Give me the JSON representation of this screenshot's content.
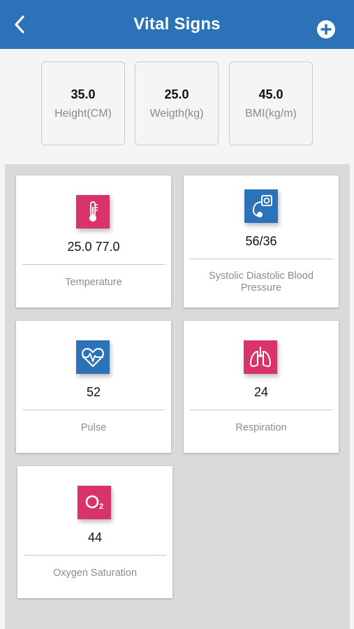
{
  "header": {
    "title": "Vital Signs",
    "back_icon": "chevron-left-icon",
    "add_icon": "plus-circle-icon",
    "color": "#2b72b8"
  },
  "metrics": [
    {
      "value": "35.0",
      "label": "Height(CM)"
    },
    {
      "value": "25.0",
      "label": "Weigth(kg)"
    },
    {
      "value": "45.0",
      "label": "BMI(kg/m)"
    }
  ],
  "cards": [
    {
      "icon": "thermometer-icon",
      "icon_color": "#d8346b",
      "value": "25.0  77.0",
      "name": "Temperature"
    },
    {
      "icon": "blood-pressure-icon",
      "icon_color": "#2b72b8",
      "value": "56/36",
      "name": "Systolic Diastolic Blood Pressure"
    },
    {
      "icon": "heart-pulse-icon",
      "icon_color": "#2b72b8",
      "value": "52",
      "name": "Pulse"
    },
    {
      "icon": "lungs-icon",
      "icon_color": "#d8346b",
      "value": "24",
      "name": "Respiration"
    },
    {
      "icon": "oxygen-icon",
      "icon_color": "#d8346b",
      "value": "44",
      "name": "Oxygen Saturation"
    }
  ]
}
